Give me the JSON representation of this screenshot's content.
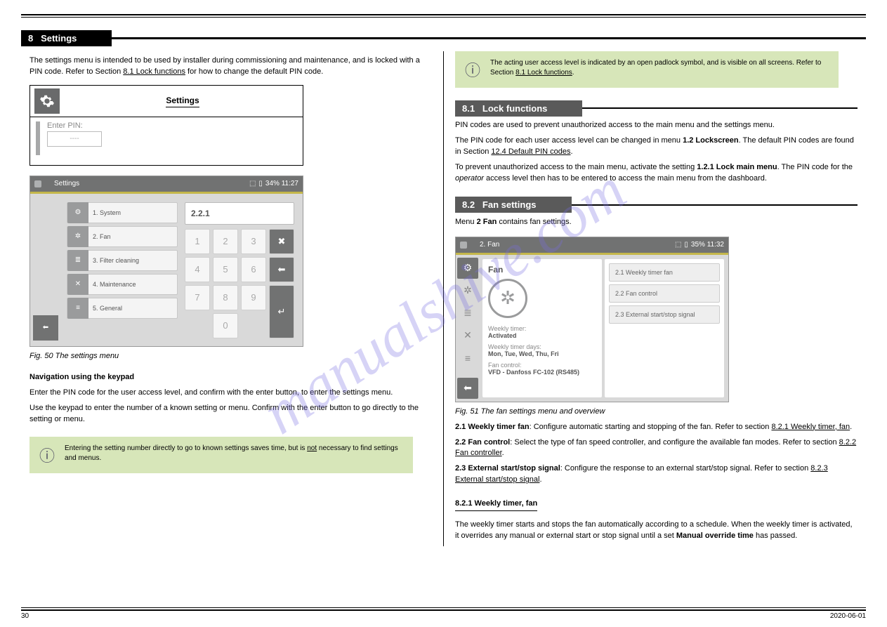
{
  "watermark": "manualshive.com",
  "section8": {
    "num": "8",
    "title": "Settings"
  },
  "left": {
    "p1a": "The settings menu is intended to be used by installer during commissioning and maintenance, and is locked with a PIN code. Refer to Section ",
    "p1_ref": "8.1 Lock functions",
    "p1b": " for how to change the default PIN code.",
    "pinbox": {
      "title": "Settings",
      "label": "Enter PIN:",
      "placeholder": "----"
    },
    "ui1": {
      "title": "Settings",
      "status": "34%  11:27",
      "menu": [
        "1. System",
        "2. Fan",
        "3. Filter cleaning",
        "4. Maintenance",
        "5. General"
      ],
      "display": "2.2.1",
      "keys": [
        "1",
        "2",
        "3",
        "4",
        "5",
        "6",
        "7",
        "8",
        "9",
        "0"
      ]
    },
    "caption": "Fig. 50 The settings menu",
    "nav": {
      "h": "Navigation using the keypad",
      "t1": "Enter the PIN code for the user access level, and confirm with the enter button, to enter the settings menu.",
      "t2": "Use the keypad to enter the number of a known setting or menu. Confirm with the enter button to go directly to the setting or menu."
    },
    "note": {
      "b": "Entering the setting number directly to go to known settings saves time, but is ",
      "u": "not",
      "c": " necessary to find settings and menus."
    }
  },
  "right": {
    "note": {
      "a": "The acting user access level is indicated by an open padlock symbol, and is visible on all screens. Refer to Section ",
      "ref": "8.1 Lock functions",
      "b": "."
    },
    "sec81": {
      "num": "8.1",
      "title": "Lock functions"
    },
    "p1": "PIN codes are used to prevent unauthorized access to the main menu and the settings menu.",
    "p2a": "The PIN code for each user access level can be changed in menu ",
    "p2b": "1.2 Lockscreen",
    "p2c": ". The default PIN codes are found in Section ",
    "p2ref": "12.4 Default PIN codes",
    "p2d": ".",
    "p3a": "To prevent unauthorized access to the main menu, activate the setting ",
    "p3b": "1.2.1 Lock main menu",
    "p3c": ". The PIN code for the ",
    "p3d": "operator",
    "p3e": " access level then has to be entered to access the main menu from the dashboard.",
    "sec82": {
      "num": "8.2",
      "title": "Fan settings"
    },
    "p4a": "Menu ",
    "p4b": "2 Fan",
    "p4c": " contains fan settings.",
    "ui2": {
      "title": "2. Fan",
      "status": "35%  11:32",
      "panelTitle": "Fan",
      "wt": "Weekly timer:",
      "wtv": "Activated",
      "wd": "Weekly timer days:",
      "wdv": "Mon, Tue, Wed, Thu, Fri",
      "fc": "Fan control:",
      "fcv": "VFD - Danfoss FC-102 (RS485)",
      "btns": [
        "2.1 Weekly timer fan",
        "2.2 Fan control",
        "2.3 External start/stop signal"
      ]
    },
    "caption": "Fig. 51 The fan settings menu and overview",
    "p5a": "2.1 Weekly timer fan",
    "p5b": ": Configure automatic starting and stopping of the fan. Refer to section ",
    "p5ref": "8.2.1 Weekly timer, fan",
    "p5c": ".",
    "p6a": "2.2 Fan control",
    "p6b": ": Select the type of fan speed controller, and configure the available fan modes. Refer to section ",
    "p6ref": "8.2.2 Fan controller",
    "p6c": ".",
    "p7a": "2.3 External start/stop signal",
    "p7b": ": Configure the response to an external start/stop signal. Refer to section ",
    "p7ref": "8.2.3 External start/stop signal",
    "p7c": ".",
    "h821": "8.2.1  Weekly timer, fan",
    "p8a": "The weekly timer starts and stops the fan automatically according to a schedule. When the weekly timer is activated, it overrides any manual or external start or stop signal until a set ",
    "p8b": "Manual override time",
    "p8c": " has passed."
  },
  "footer": {
    "left": "30",
    "right": "2020-06-01"
  }
}
